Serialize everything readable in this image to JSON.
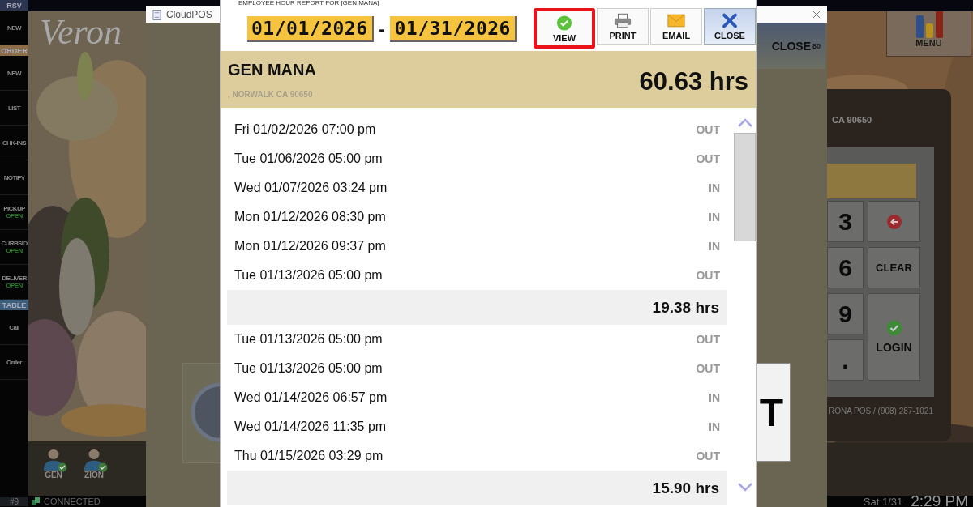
{
  "background": {
    "logo": "Veron"
  },
  "sidebar": [
    {
      "kind": "header",
      "label": "RSV",
      "color": "#2b3550"
    },
    {
      "kind": "button",
      "label": "NEW"
    },
    {
      "kind": "header",
      "label": "ORDER",
      "color": "#8c6d48"
    },
    {
      "kind": "button",
      "label": "NEW"
    },
    {
      "kind": "button",
      "label": "LIST"
    },
    {
      "kind": "button",
      "label": "CHK-INS"
    },
    {
      "kind": "button",
      "label": "NOTIFY"
    },
    {
      "kind": "button",
      "label": "PICKUP",
      "status": "OPEN"
    },
    {
      "kind": "button",
      "label": "CURBSID",
      "status": "OPEN"
    },
    {
      "kind": "button",
      "label": "DELIVER",
      "status": "OPEN"
    },
    {
      "kind": "header",
      "label": "TABLE",
      "color": "#3d5f7c"
    },
    {
      "kind": "button",
      "label": "Call"
    },
    {
      "kind": "button",
      "label": "Order"
    }
  ],
  "users": [
    {
      "name": "GEN",
      "checked": true
    },
    {
      "name": "ZION",
      "checked": true
    }
  ],
  "status_bar": {
    "station": "#9",
    "connection": "CONNECTED",
    "date": "Sat 1/31",
    "time": "2:29 PM"
  },
  "pos_window": {
    "title": "CloudPOS",
    "close_button": {
      "label": "CLOSE",
      "badge": "80"
    },
    "key": "T"
  },
  "login_panel": {
    "address": "CA 90650",
    "keys": [
      {
        "kind": "digit",
        "label": "3"
      },
      {
        "kind": "back"
      },
      {
        "kind": "digit",
        "label": "6"
      },
      {
        "kind": "text",
        "label": "CLEAR"
      },
      {
        "kind": "digit",
        "label": "9"
      },
      {
        "kind": "login",
        "label": "LOGIN"
      },
      {
        "kind": "digit",
        "label": "."
      }
    ],
    "footer": "RONA POS / (908) 287-1021"
  },
  "menu_button": {
    "label": "MENU"
  },
  "report": {
    "title": "EMPLOYEE HOUR REPORT FOR [GEN MANA]",
    "start_date": "01/01/2026",
    "separator": "-",
    "end_date": "01/31/2026",
    "toolbar": [
      {
        "kind": "view",
        "label": "VIEW",
        "selected": true
      },
      {
        "kind": "print",
        "label": "PRINT",
        "selected": false
      },
      {
        "kind": "email",
        "label": "EMAIL",
        "selected": false
      },
      {
        "kind": "close",
        "label": "CLOSE",
        "selected": false
      }
    ],
    "employee": "GEN MANA",
    "address": ", NORWALK CA 90650",
    "total": "60.63 hrs",
    "rows": [
      {
        "kind": "punch",
        "time": "Fri 01/02/2026 07:00 pm",
        "direction": "OUT"
      },
      {
        "kind": "punch",
        "time": "Tue 01/06/2026 05:00 pm",
        "direction": "OUT"
      },
      {
        "kind": "punch",
        "time": "Wed 01/07/2026 03:24 pm",
        "direction": "IN"
      },
      {
        "kind": "punch",
        "time": "Mon 01/12/2026 08:30 pm",
        "direction": "IN"
      },
      {
        "kind": "punch",
        "time": "Mon 01/12/2026 09:37 pm",
        "direction": "IN"
      },
      {
        "kind": "punch",
        "time": "Tue 01/13/2026 05:00 pm",
        "direction": "OUT"
      },
      {
        "kind": "total",
        "value": "19.38 hrs"
      },
      {
        "kind": "punch",
        "time": "Tue 01/13/2026 05:00 pm",
        "direction": "OUT"
      },
      {
        "kind": "punch",
        "time": "Tue 01/13/2026 05:00 pm",
        "direction": "OUT"
      },
      {
        "kind": "punch",
        "time": "Wed 01/14/2026 06:57 pm",
        "direction": "IN"
      },
      {
        "kind": "punch",
        "time": "Wed 01/14/2026 11:35 pm",
        "direction": "IN"
      },
      {
        "kind": "punch",
        "time": "Thu 01/15/2026 03:29 pm",
        "direction": "OUT"
      },
      {
        "kind": "total",
        "value": "15.90 hrs"
      }
    ]
  }
}
